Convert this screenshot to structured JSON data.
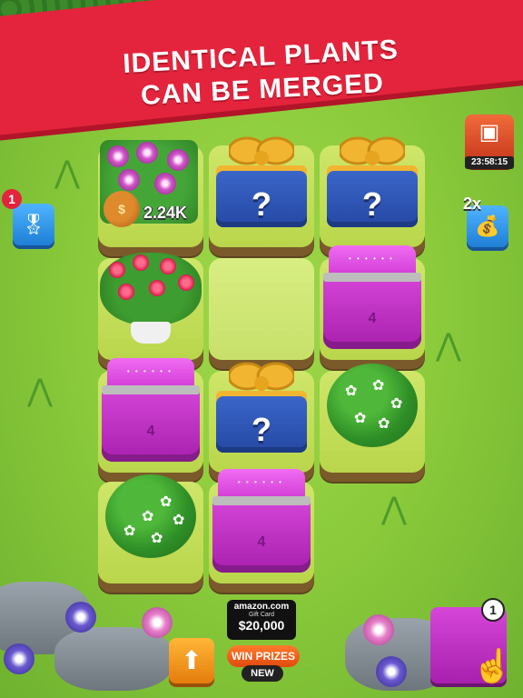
{
  "banner": {
    "line1": "IDENTICAL PLANTS",
    "line2": "CAN BE MERGED"
  },
  "colors": {
    "banner_red": "#e4243c",
    "grass_green": "#8ccc3c",
    "chest_purple": "#d646d9",
    "gift_blue": "#2548a3"
  },
  "grid": {
    "rows": 4,
    "cols": 3,
    "cells": [
      {
        "type": "petunia",
        "income": "2.24K"
      },
      {
        "type": "gift",
        "label": "?"
      },
      {
        "type": "gift",
        "label": "?"
      },
      {
        "type": "roses"
      },
      {
        "type": "empty"
      },
      {
        "type": "chest",
        "level": "4"
      },
      {
        "type": "chest",
        "level": "4"
      },
      {
        "type": "gift",
        "label": "?"
      },
      {
        "type": "bush"
      },
      {
        "type": "bush"
      },
      {
        "type": "chest",
        "level": "4"
      }
    ]
  },
  "left_button": {
    "badge": "1",
    "icon": "ribbon-award-icon"
  },
  "right_button": {
    "multiplier": "2x",
    "icon": "video-moneybag-icon"
  },
  "timer": {
    "value": "23:58:15",
    "icon": "treasure-box-icon"
  },
  "bottom": {
    "upload_icon": "arrow-up-icon",
    "amazon": {
      "logo": "amazon.com",
      "sub": "Gift Card",
      "amount": "$20,000"
    },
    "win_prizes": "WIN PRIZES",
    "new_tag": "NEW",
    "preview_count": "1",
    "hand_icon": "pointing-hand-icon"
  }
}
